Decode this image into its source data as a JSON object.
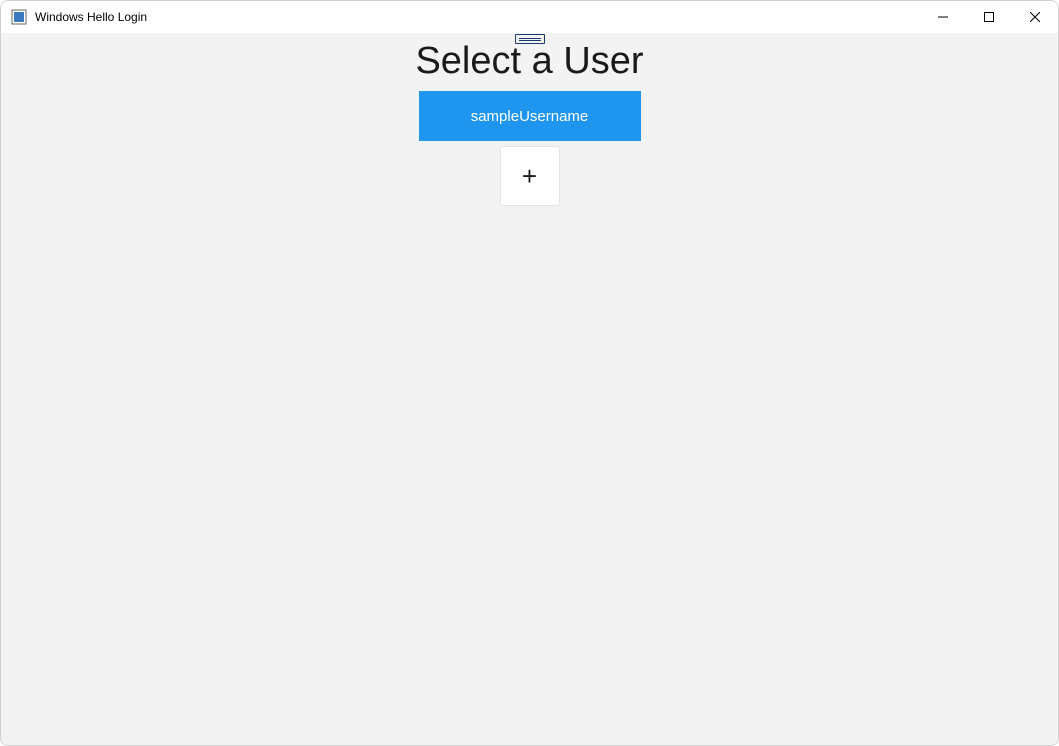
{
  "window": {
    "title": "Windows Hello Login"
  },
  "main": {
    "heading": "Select a User",
    "users": [
      {
        "username": "sampleUsername"
      }
    ],
    "add_label": "+"
  },
  "colors": {
    "accent": "#1e95ef",
    "client_bg": "#f3f3f3"
  }
}
